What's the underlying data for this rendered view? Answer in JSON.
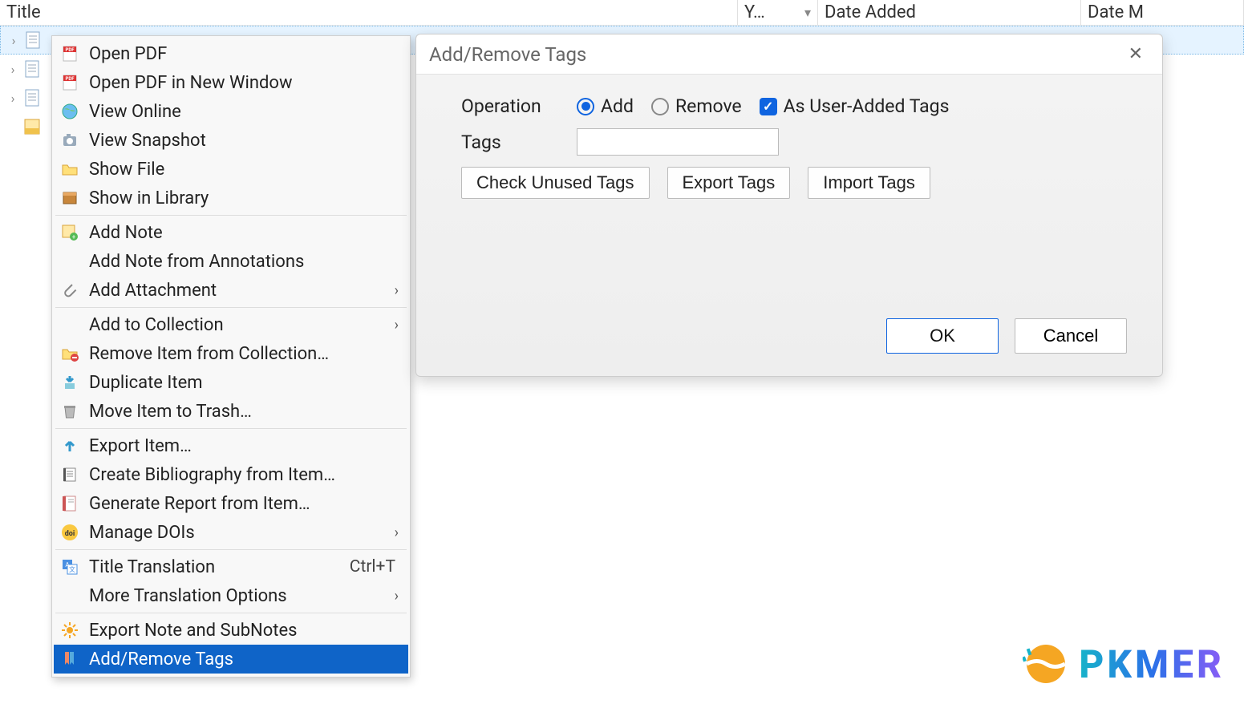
{
  "columns": {
    "title": "Title",
    "year": "Y…",
    "date_added": "Date Added",
    "date_m": "Date M"
  },
  "context_menu": {
    "items": [
      {
        "label": "Open PDF",
        "icon": "pdf-icon"
      },
      {
        "label": "Open PDF in New Window",
        "icon": "pdf-icon"
      },
      {
        "label": "View Online",
        "icon": "globe-icon"
      },
      {
        "label": "View Snapshot",
        "icon": "camera-icon"
      },
      {
        "label": "Show File",
        "icon": "folder-icon"
      },
      {
        "label": "Show in Library",
        "icon": "library-icon"
      },
      {
        "sep": true
      },
      {
        "label": "Add Note",
        "icon": "note-add-icon"
      },
      {
        "label": "Add Note from Annotations",
        "icon": ""
      },
      {
        "label": "Add Attachment",
        "icon": "paperclip-icon",
        "submenu": true
      },
      {
        "sep": true
      },
      {
        "label": "Add to Collection",
        "icon": "",
        "submenu": true
      },
      {
        "label": "Remove Item from Collection…",
        "icon": "folder-remove-icon"
      },
      {
        "label": "Duplicate Item",
        "icon": "duplicate-icon"
      },
      {
        "label": "Move Item to Trash…",
        "icon": "trash-icon"
      },
      {
        "sep": true
      },
      {
        "label": "Export Item…",
        "icon": "export-icon"
      },
      {
        "label": "Create Bibliography from Item…",
        "icon": "biblio-icon"
      },
      {
        "label": "Generate Report from Item…",
        "icon": "report-icon"
      },
      {
        "label": "Manage DOIs",
        "icon": "doi-icon",
        "submenu": true
      },
      {
        "sep": true
      },
      {
        "label": "Title Translation",
        "icon": "translate-icon",
        "shortcut": "Ctrl+T"
      },
      {
        "label": "More Translation Options",
        "icon": "",
        "submenu": true
      },
      {
        "sep": true
      },
      {
        "label": "Export Note and SubNotes",
        "icon": "export-note-icon"
      },
      {
        "label": "Add/Remove Tags",
        "icon": "tags-icon",
        "highlight": true
      }
    ]
  },
  "dialog": {
    "title": "Add/Remove Tags",
    "operation_label": "Operation",
    "add_label": "Add",
    "remove_label": "Remove",
    "user_added_label": "As User-Added Tags",
    "tags_label": "Tags",
    "tags_value": "",
    "check_unused": "Check Unused Tags",
    "export_tags": "Export Tags",
    "import_tags": "Import Tags",
    "ok": "OK",
    "cancel": "Cancel",
    "add_selected": true,
    "user_added_checked": true
  },
  "watermark": {
    "text": "PKMER"
  }
}
